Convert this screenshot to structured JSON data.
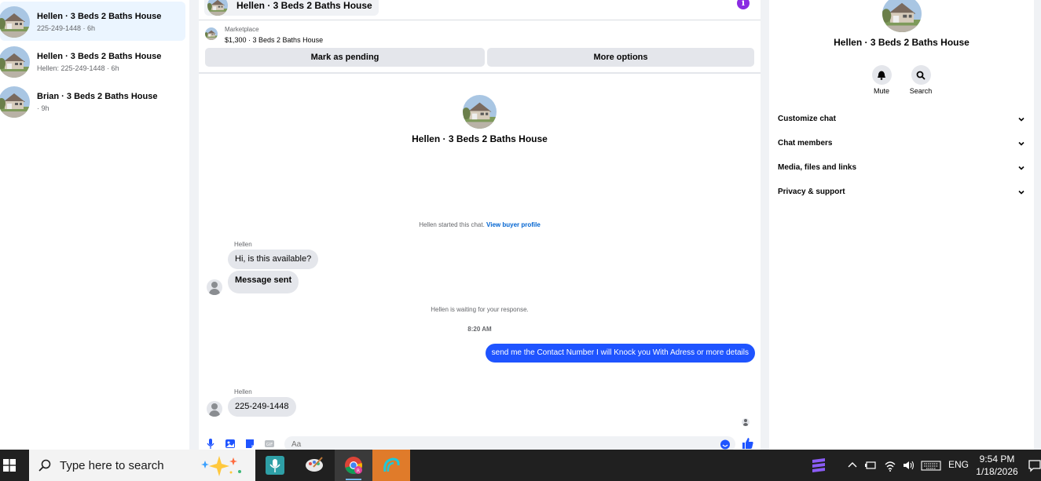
{
  "conversations": [
    {
      "name": "Hellen · 3 Beds 2 Baths House",
      "preview": "225-249-1448 · 6h",
      "active": true
    },
    {
      "name": "Hellen · 3 Beds 2 Baths House",
      "preview": "Hellen: 225-249-1448 · 6h",
      "active": false
    },
    {
      "name": "Brian · 3 Beds 2 Baths House",
      "preview": " · 9h",
      "active": false
    }
  ],
  "chat": {
    "header_title": "Hellen · 3 Beds 2 Baths House",
    "marketplace_label": "Marketplace",
    "listing_detail": "$1,300 · 3 Beds 2 Baths House",
    "mark_pending_label": "Mark as pending",
    "more_options_label": "More options",
    "title": "Hellen · 3 Beds 2 Baths House",
    "started_text": "Hellen started this chat.",
    "view_buyer_profile": "View buyer profile",
    "sender1": "Hellen",
    "msg1": "Hi, is this available?",
    "msg2": "Message sent",
    "waiting_text": "Hellen is waiting for your response.",
    "timestamp": "8:20 AM",
    "outgoing": "send me the Contact Number I will Knock you With Adress or more details",
    "sender2": "Hellen",
    "msg3": "225-249-1448",
    "composer_placeholder": "Aa"
  },
  "details": {
    "title": "Hellen · 3 Beds 2 Baths House",
    "mute_label": "Mute",
    "search_label": "Search",
    "sections": [
      "Customize chat",
      "Chat members",
      "Media, files and links",
      "Privacy & support"
    ]
  },
  "taskbar": {
    "search_placeholder": "Type here to search",
    "language": "ENG",
    "time": "9:54 PM",
    "date": "1/18/2026"
  },
  "colors": {
    "accent_blue": "#1f54ff",
    "link_blue": "#0064d1",
    "info_purple": "#8a2be2",
    "active_row": "#ebf5ff"
  }
}
